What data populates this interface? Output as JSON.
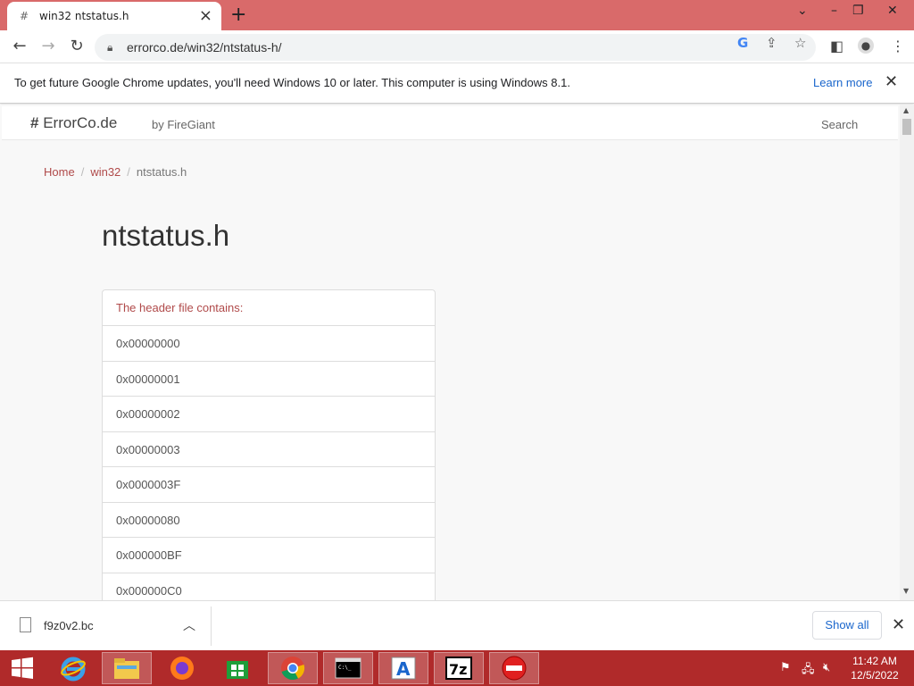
{
  "browser": {
    "tab_title": "win32 ntstatus.h",
    "tab_favicon": "#",
    "url": "errorco.de/win32/ntstatus-h/"
  },
  "infobar": {
    "message": "To get future Google Chrome updates, you'll need Windows 10 or later. This computer is using Windows 8.1.",
    "learn_more": "Learn more"
  },
  "site": {
    "brand_symbol": "#",
    "brand": "ErrorCo.de",
    "byline": "by FireGiant",
    "search": "Search"
  },
  "breadcrumb": {
    "home": "Home",
    "section": "win32",
    "current": "ntstatus.h"
  },
  "main": {
    "title": "ntstatus.h",
    "list_header": "The header file contains:",
    "items": [
      "0x00000000",
      "0x00000001",
      "0x00000002",
      "0x00000003",
      "0x0000003F",
      "0x00000080",
      "0x000000BF",
      "0x000000C0"
    ]
  },
  "downloads": {
    "file_name": "f9z0v2.bc",
    "show_all": "Show all"
  },
  "taskbar": {
    "time": "11:42 AM",
    "date": "12/5/2022"
  },
  "colors": {
    "tabbar": "#d96a6a",
    "taskbar": "#b02a2a",
    "accent_link": "#b04a4a",
    "chrome_link": "#1a66cc"
  }
}
